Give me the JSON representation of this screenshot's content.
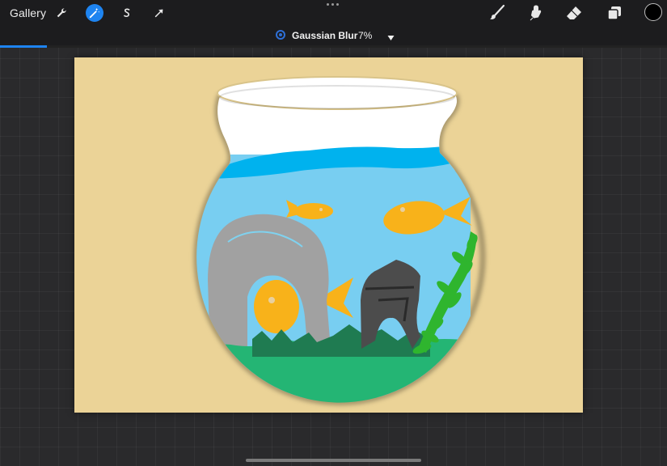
{
  "toolbar": {
    "gallery_label": "Gallery",
    "left_tools": [
      {
        "name": "actions-wrench-icon",
        "active": false
      },
      {
        "name": "adjustments-magic-wand-icon",
        "active": true
      },
      {
        "name": "selection-s-icon",
        "active": false
      },
      {
        "name": "transform-arrow-icon",
        "active": false
      }
    ],
    "right_tools": [
      "brush-icon",
      "smudge-icon",
      "eraser-icon",
      "layers-icon"
    ],
    "current_color": "#000000",
    "accent_color": "#1e84f0"
  },
  "adjustment": {
    "name": "Gaussian Blur",
    "value": "7%",
    "level_percent": 7,
    "icon": "gaussian-blur-icon",
    "dropdown_icon": "caret-down-icon"
  },
  "canvas": {
    "background_color": "#ebd397",
    "content": "fish bowl illustration"
  }
}
